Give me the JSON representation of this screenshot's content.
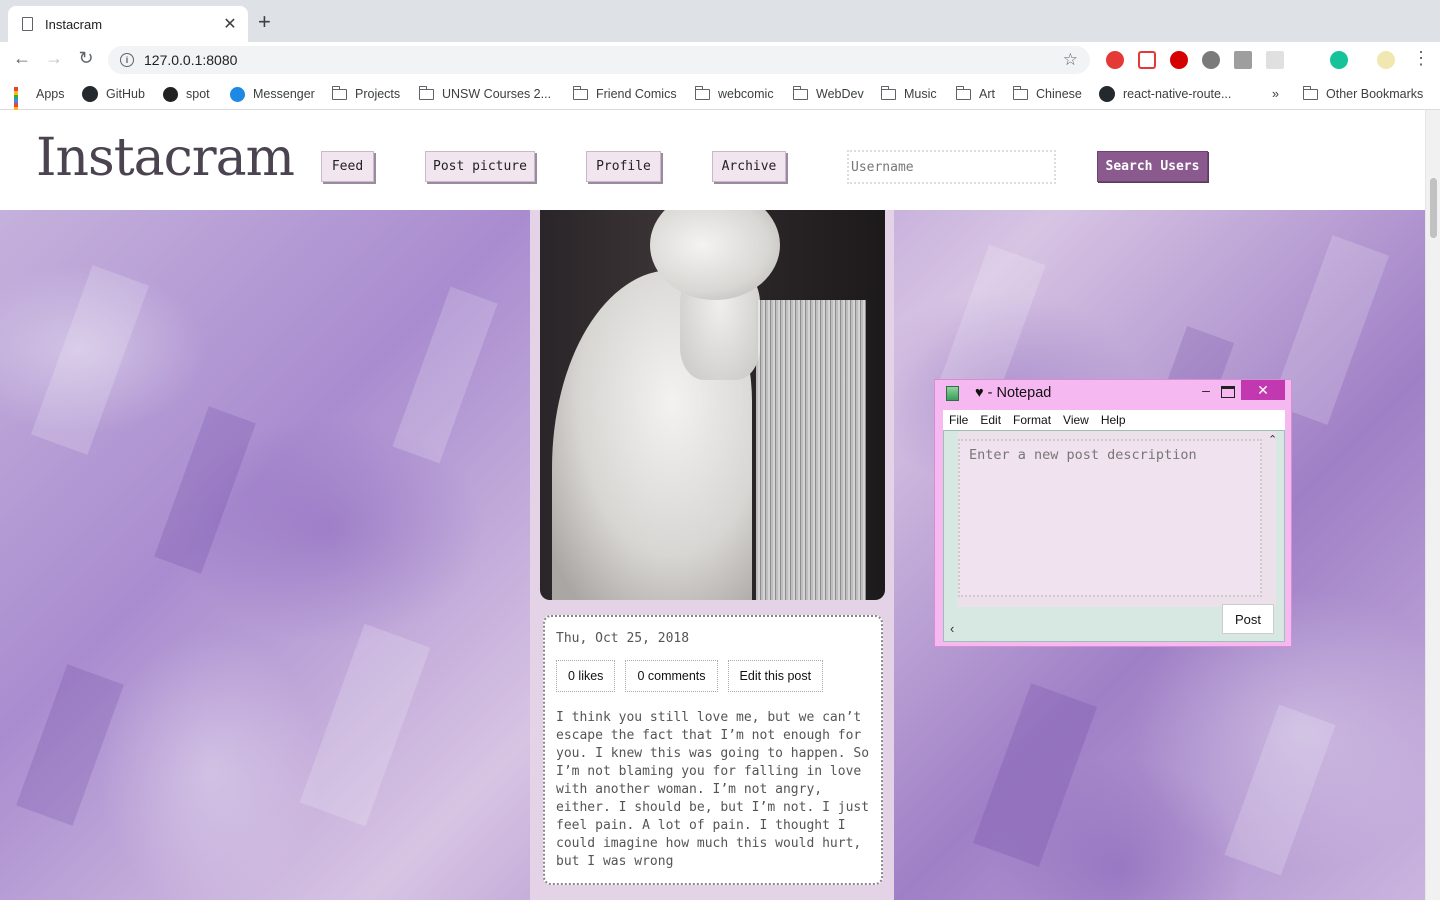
{
  "browser": {
    "tab_title": "Instacram",
    "url": "127.0.0.1:8080",
    "bookmarks": [
      {
        "label": "Apps",
        "icon": "apps-grid-icon"
      },
      {
        "label": "GitHub",
        "icon": "github-icon"
      },
      {
        "label": "spot",
        "icon": "spotify-icon"
      },
      {
        "label": "Messenger",
        "icon": "messenger-icon"
      },
      {
        "label": "Projects",
        "icon": "folder-icon"
      },
      {
        "label": "UNSW Courses 2...",
        "icon": "folder-icon"
      },
      {
        "label": "Friend Comics",
        "icon": "folder-icon"
      },
      {
        "label": "webcomic",
        "icon": "folder-icon"
      },
      {
        "label": "WebDev",
        "icon": "folder-icon"
      },
      {
        "label": "Music",
        "icon": "folder-icon"
      },
      {
        "label": "Art",
        "icon": "folder-icon"
      },
      {
        "label": "Chinese",
        "icon": "folder-icon"
      },
      {
        "label": "react-native-route...",
        "icon": "github-icon"
      },
      {
        "label": "»",
        "icon": "overflow-chevron-icon"
      },
      {
        "label": "Other Bookmarks",
        "icon": "folder-icon"
      }
    ]
  },
  "header": {
    "logo": "Instacram",
    "nav": {
      "feed": "Feed",
      "post_picture": "Post picture",
      "profile": "Profile",
      "archive": "Archive"
    },
    "search_placeholder": "Username",
    "search_button": "Search Users"
  },
  "post": {
    "date": "Thu, Oct 25, 2018",
    "likes": "0 likes",
    "comments": "0 comments",
    "edit": "Edit this post",
    "description": "I think you still love me, but we can’t escape the fact that I’m not enough for you. I knew this was going to happen. So I’m not blaming you for falling in love with another woman. I’m not angry, either. I should be, but I’m not. I just feel pain. A lot of pain. I thought I could imagine how much this would hurt, but I was wrong"
  },
  "notepad": {
    "title": "♥ - Notepad",
    "menu": [
      "File",
      "Edit",
      "Format",
      "View",
      "Help"
    ],
    "textarea_placeholder": "Enter a new post description",
    "post_button": "Post",
    "close_glyph": "✕",
    "minimize_glyph": "–"
  },
  "colors": {
    "accent_purple": "#8a5a8e",
    "notepad_pink": "#f5b8f0",
    "notepad_close": "#c238b0",
    "post_column_bg": "#e4d3e7"
  }
}
